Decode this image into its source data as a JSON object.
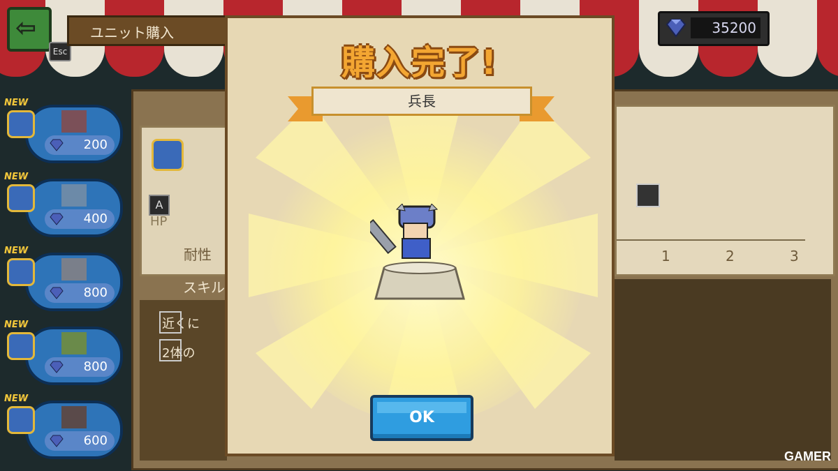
{
  "header": {
    "back_label": "⇦",
    "esc_label": "Esc",
    "title": "ユニット購入",
    "gem_count": "35200"
  },
  "unit_list": [
    {
      "new_label": "NEW",
      "price": "200"
    },
    {
      "new_label": "NEW",
      "price": "400"
    },
    {
      "new_label": "NEW",
      "price": "800"
    },
    {
      "new_label": "NEW",
      "price": "800"
    },
    {
      "new_label": "NEW",
      "price": "600"
    }
  ],
  "detail": {
    "hp_label": "HP",
    "durability_label": "耐性",
    "skill_label": "スキル",
    "skill_1": "近くに",
    "skill_2": "2体の",
    "a_key": "A",
    "axis_ticks": [
      "1",
      "2",
      "3"
    ]
  },
  "modal": {
    "title": "購入完了!",
    "unit_name": "兵長",
    "ok_label": "OK"
  },
  "watermark": "GAMER",
  "colors": {
    "accent": "#f3a632",
    "ok_button": "#2f9de0",
    "modal_bg": "#e7d8b4"
  }
}
